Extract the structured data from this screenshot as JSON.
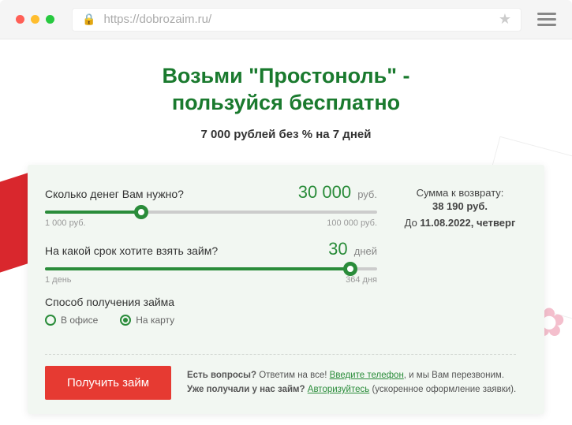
{
  "browser": {
    "url": "https://dobrozaim.ru/"
  },
  "hero": {
    "title_line1": "Возьми \"Простоноль\" -",
    "title_line2": "пользуйся бесплатно",
    "subtitle": "7 000 рублей без % на 7 дней"
  },
  "calc": {
    "amount": {
      "label": "Сколько денег Вам нужно?",
      "value": "30 000",
      "unit": "руб.",
      "min": "1 000 руб.",
      "max": "100 000 руб.",
      "percent": 29
    },
    "term": {
      "label": "На какой срок хотите взять займ?",
      "value": "30",
      "unit": "дней",
      "min": "1 день",
      "max": "364 дня",
      "percent": 92
    },
    "method": {
      "label": "Способ получения займа",
      "options": [
        {
          "label": "В офисе",
          "selected": false
        },
        {
          "label": "На карту",
          "selected": true
        }
      ]
    },
    "return": {
      "label": "Сумма к возврату:",
      "amount": "38 190 руб.",
      "date_prefix": "До ",
      "date": "11.08.2022, четверг"
    },
    "submit": "Получить займ",
    "footer": {
      "q_prefix": "Есть вопросы? ",
      "q_mid": "Ответим на все! ",
      "q_link": "Введите телефон",
      "q_suffix": ", и мы Вам перезвоним.",
      "a_prefix": "Уже получали у нас займ? ",
      "a_link": "Авторизуйтесь",
      "a_suffix": " (ускоренное оформление заявки)."
    }
  }
}
